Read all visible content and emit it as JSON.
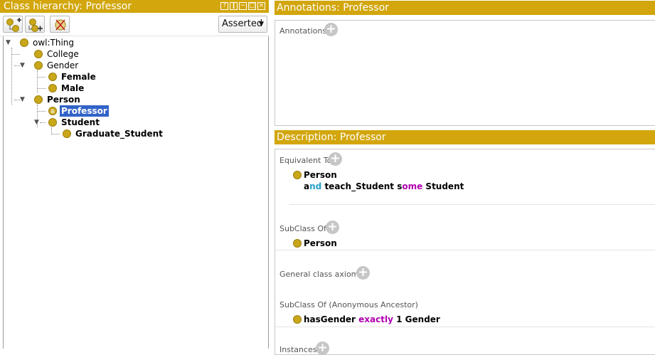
{
  "left_panel": {
    "title": "Class hierarchy: Professor",
    "window_controls": [
      "?",
      "❙",
      "−",
      "□",
      "×"
    ],
    "toolbar": {
      "add_subclass": "add-subclass-icon",
      "add_sibling": "add-sibling-icon",
      "delete": "delete-class-icon",
      "view_mode": "Asserted"
    },
    "tree": {
      "owl_thing": "owl:Thing",
      "college": "College",
      "gender": "Gender",
      "female": "Female",
      "male": "Male",
      "person": "Person",
      "professor": "Professor",
      "student": "Student",
      "graduate_student": "Graduate_Student"
    }
  },
  "annotations_panel": {
    "title": "Annotations: Professor",
    "annotations_label": "Annotations"
  },
  "description_panel": {
    "title": "Description: Professor",
    "equivalent_to": {
      "label": "Equivalent To",
      "class": "Person",
      "expr_a": "a",
      "expr_nd": "nd",
      "expr_prop": "teach_Student",
      "expr_s": "s",
      "expr_ome": "ome",
      "expr_filler": "Student"
    },
    "subclass_of": {
      "label": "SubClass Of",
      "class": "Person"
    },
    "general_axioms": {
      "label": "General class axioms"
    },
    "anon_ancestor": {
      "label": "SubClass Of (Anonymous Ancestor)",
      "prop": "hasGender",
      "kw": "exactly",
      "num": "1",
      "filler": "Gender"
    },
    "instances": {
      "label": "Instances"
    }
  },
  "colors": {
    "title_bar": "#d2a60c",
    "class_ball": "#c9a71a",
    "selection": "#3264c8",
    "keyword_cyan": "#28a0c8",
    "keyword_magenta": "#b000b0"
  }
}
